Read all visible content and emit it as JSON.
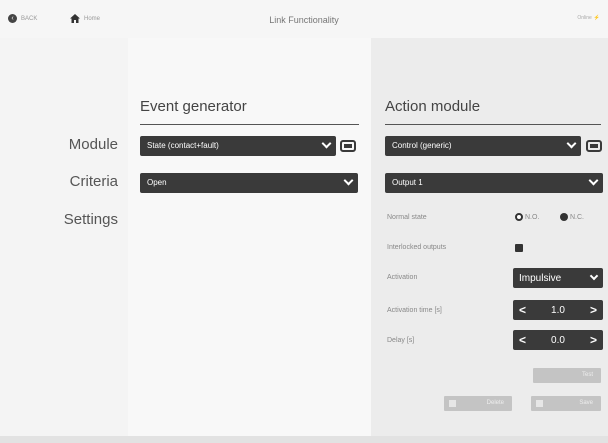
{
  "header": {
    "back_label": "BACK",
    "home_label": "Home",
    "title": "Link Functionality",
    "status_label": "Online"
  },
  "rows": {
    "module": "Module",
    "criteria": "Criteria",
    "settings": "Settings"
  },
  "event_generator": {
    "heading": "Event generator",
    "module_value": "State (contact+fault)",
    "criteria_value": "Open"
  },
  "action_module": {
    "heading": "Action module",
    "module_value": "Control (generic)",
    "output_value": "Output 1",
    "settings": {
      "normal_state_label": "Normal state",
      "nc_open_label": "N.O.",
      "nc_closed_label": "N.C.",
      "interlocked_label": "Interlocked outputs",
      "activation_label": "Activation",
      "activation_value": "Impulsive",
      "activation_time_label": "Activation time [s]",
      "activation_time_value": "1.0",
      "delay_label": "Delay [s]",
      "delay_value": "0.0"
    }
  },
  "buttons": {
    "test_label": "Test",
    "delete_label": "Delete",
    "save_label": "Save"
  }
}
